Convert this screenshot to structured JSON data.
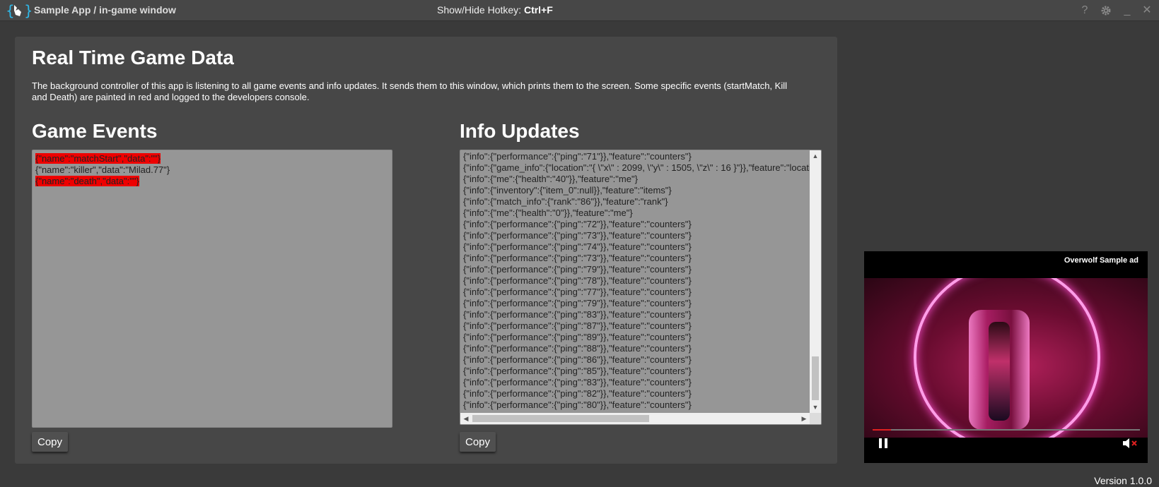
{
  "window": {
    "title": "Sample App / in-game window",
    "hotkey_label": "Show/Hide Hotkey:",
    "hotkey_value": "Ctrl+F",
    "controls": [
      "help-icon",
      "gear-icon",
      "minimize-icon",
      "close-icon"
    ],
    "help_glyph": "?",
    "minimize_glyph": "_",
    "close_glyph": "✕"
  },
  "main": {
    "title": "Real Time Game Data",
    "description": "The background controller of this app is listening to all game events and info updates. It sends them to this window, which prints them to the screen. Some specific events (startMatch, Kill and Death) are painted in red and logged to the developers console.",
    "game_events": {
      "title": "Game Events",
      "copy_label": "Copy",
      "lines": [
        {
          "text": "{\"name\":\"matchStart\",\"data\":\"\"}",
          "highlight": true
        },
        {
          "text": "{\"name\":\"killer\",\"data\":\"Milad.77\"}",
          "highlight": false
        },
        {
          "text": "{\"name\":\"death\",\"data\":\"\"}",
          "highlight": true
        }
      ]
    },
    "info_updates": {
      "title": "Info Updates",
      "copy_label": "Copy",
      "lines": [
        "{\"info\":{\"performance\":{\"ping\":\"71\"}},\"feature\":\"counters\"}",
        "{\"info\":{\"game_info\":{\"location\":\"{ \\\"x\\\" : 2099, \\\"y\\\" : 1505, \\\"z\\\" : 16 }\"}},\"feature\":\"location\"}",
        "{\"info\":{\"me\":{\"health\":\"40\"}},\"feature\":\"me\"}",
        "{\"info\":{\"inventory\":{\"item_0\":null}},\"feature\":\"items\"}",
        "{\"info\":{\"match_info\":{\"rank\":\"86\"}},\"feature\":\"rank\"}",
        "{\"info\":{\"me\":{\"health\":\"0\"}},\"feature\":\"me\"}",
        "{\"info\":{\"performance\":{\"ping\":\"72\"}},\"feature\":\"counters\"}",
        "{\"info\":{\"performance\":{\"ping\":\"73\"}},\"feature\":\"counters\"}",
        "{\"info\":{\"performance\":{\"ping\":\"74\"}},\"feature\":\"counters\"}",
        "{\"info\":{\"performance\":{\"ping\":\"73\"}},\"feature\":\"counters\"}",
        "{\"info\":{\"performance\":{\"ping\":\"79\"}},\"feature\":\"counters\"}",
        "{\"info\":{\"performance\":{\"ping\":\"78\"}},\"feature\":\"counters\"}",
        "{\"info\":{\"performance\":{\"ping\":\"77\"}},\"feature\":\"counters\"}",
        "{\"info\":{\"performance\":{\"ping\":\"79\"}},\"feature\":\"counters\"}",
        "{\"info\":{\"performance\":{\"ping\":\"83\"}},\"feature\":\"counters\"}",
        "{\"info\":{\"performance\":{\"ping\":\"87\"}},\"feature\":\"counters\"}",
        "{\"info\":{\"performance\":{\"ping\":\"89\"}},\"feature\":\"counters\"}",
        "{\"info\":{\"performance\":{\"ping\":\"88\"}},\"feature\":\"counters\"}",
        "{\"info\":{\"performance\":{\"ping\":\"86\"}},\"feature\":\"counters\"}",
        "{\"info\":{\"performance\":{\"ping\":\"85\"}},\"feature\":\"counters\"}",
        "{\"info\":{\"performance\":{\"ping\":\"83\"}},\"feature\":\"counters\"}",
        "{\"info\":{\"performance\":{\"ping\":\"82\"}},\"feature\":\"counters\"}",
        "{\"info\":{\"performance\":{\"ping\":\"80\"}},\"feature\":\"counters\"}"
      ]
    }
  },
  "ad": {
    "label": "Overwolf Sample ad",
    "progress": 0.07,
    "controls": [
      "pause-icon",
      "mute-icon"
    ]
  },
  "footer": {
    "version": "Version 1.0.0"
  },
  "colors": {
    "background": "#3a3a3a",
    "panel": "#474747",
    "log_box": "#969696",
    "highlight": "#ee0000",
    "logo_accent": "#2fb8e8"
  }
}
